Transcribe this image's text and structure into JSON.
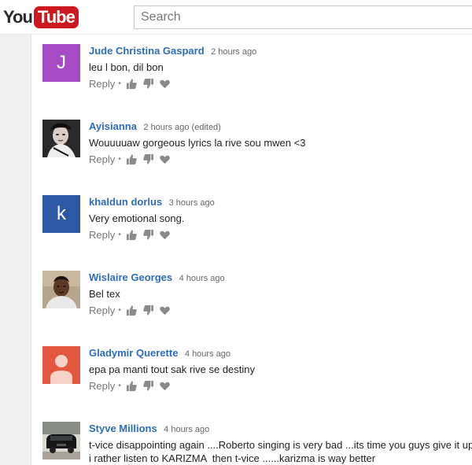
{
  "header": {
    "logo_you": "You",
    "logo_tube": "Tube",
    "search_placeholder": "Search"
  },
  "comments": [
    {
      "author": "Jude Christina Gaspard",
      "time": "2 hours ago",
      "text": "leu l bon,  dil bon",
      "avatar": {
        "type": "letter",
        "letter": "J",
        "color": "#a64bc4"
      }
    },
    {
      "author": "Ayisianna",
      "time": "2 hours ago (edited)",
      "text": "Wouuuuaw gorgeous lyrics la rive sou mwen  <3",
      "avatar": {
        "type": "photo",
        "icon": "portrait-photo-bw"
      }
    },
    {
      "author": "khaldun dorlus",
      "time": "3 hours ago",
      "text": "Very emotional song.",
      "avatar": {
        "type": "letter",
        "letter": "k",
        "color": "#2d58a3"
      }
    },
    {
      "author": "Wislaire Georges",
      "time": "4 hours ago",
      "text": "Bel tex",
      "avatar": {
        "type": "photo",
        "icon": "portrait-photo-color"
      }
    },
    {
      "author": "Gladymir Querette",
      "time": "4 hours ago",
      "text": "epa pa manti tout sak rive se destiny",
      "avatar": {
        "type": "default",
        "icon": "default-user-avatar",
        "color": "#e4573f"
      }
    },
    {
      "author": "Styve Millions",
      "time": "4 hours ago",
      "text": "t-vice disappointing again ....Roberto singing is very bad ...its time you guys give it up\ni rather listen to KARIZMA  then t-vice ......karizma is way better",
      "avatar": {
        "type": "photo",
        "icon": "car-photo"
      }
    }
  ],
  "actions": {
    "reply_label": "Reply",
    "separator": "•",
    "icons": [
      "thumbs-up-icon",
      "thumbs-down-icon",
      "heart-icon"
    ]
  }
}
